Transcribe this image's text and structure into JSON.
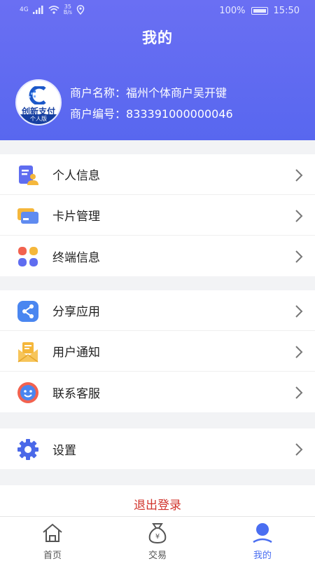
{
  "status_bar": {
    "network": "4G",
    "speed_value": "35",
    "speed_unit": "B/s",
    "battery": "100%",
    "time": "15:50"
  },
  "header": {
    "title": "我的"
  },
  "logo": {
    "brand_text": "创新支付",
    "subtitle": "个人版"
  },
  "merchant": {
    "name_label": "商户名称：",
    "name_value": "福州个体商户吴开键",
    "id_label": "商户编号：",
    "id_value": "833391000000046"
  },
  "sections": [
    {
      "items": [
        {
          "label": "个人信息",
          "icon": "personal-info-icon"
        },
        {
          "label": "卡片管理",
          "icon": "card-icon"
        },
        {
          "label": "终端信息",
          "icon": "terminal-icon"
        }
      ]
    },
    {
      "items": [
        {
          "label": "分享应用",
          "icon": "share-icon"
        },
        {
          "label": "用户通知",
          "icon": "notification-icon"
        },
        {
          "label": "联系客服",
          "icon": "customer-service-icon"
        }
      ]
    },
    {
      "items": [
        {
          "label": "设置",
          "icon": "gear-icon"
        }
      ]
    }
  ],
  "logout": {
    "label": "退出登录",
    "color": "#d1342c"
  },
  "tabbar": {
    "tabs": [
      {
        "label": "首页",
        "icon": "home-icon"
      },
      {
        "label": "交易",
        "icon": "money-bag-icon"
      },
      {
        "label": "我的",
        "icon": "user-icon",
        "active": true
      }
    ]
  },
  "colors": {
    "header_gradient_top": "#6a6ff3",
    "header_gradient_bottom": "#5867ef",
    "accent": "#4a6ef1"
  }
}
